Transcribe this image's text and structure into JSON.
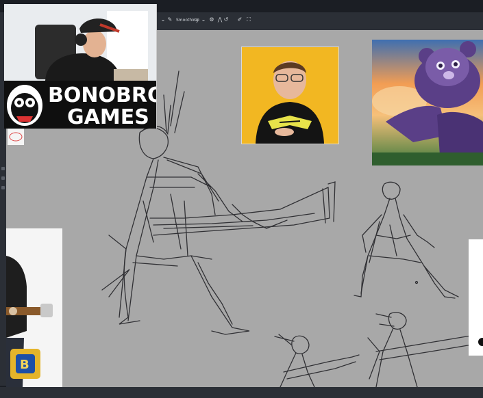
{
  "toolbar": {
    "smoothing_label": "Smoothing:"
  },
  "overlay": {
    "logo_line1": "BONOBROS",
    "logo_line2": "GAMES"
  },
  "colors": {
    "app_background": "#1b1e24",
    "canvas_background": "#a8a8a8",
    "sketch_stroke": "#2a2a2e",
    "portrait_background": "#f2b722",
    "jersey_accent": "#e8e34a"
  },
  "icons": [
    "webcam-overlay",
    "bonobros-logo-icon",
    "portrait-reference",
    "bear-reference",
    "guitarist-reference",
    "game-badge-icon"
  ]
}
